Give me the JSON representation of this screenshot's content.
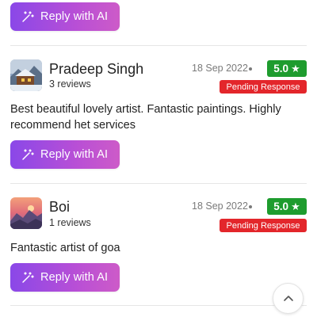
{
  "reply_button_label": "Reply with AI",
  "reviews": [
    {
      "name": "Pradeep Singh",
      "review_count": "3 reviews",
      "date": "18 Sep 2022",
      "rating": "5.0",
      "status": "Pending Response",
      "text": "Best beautiful lovely artist. Fantastic paintings. Highly recommend het services"
    },
    {
      "name": "Boi",
      "review_count": "1 reviews",
      "date": "18 Sep 2022",
      "rating": "5.0",
      "status": "Pending Response",
      "text": "Fantastic artist of goa"
    }
  ],
  "icons": {
    "reply_button": "magic-wand-icon",
    "rating": "star-icon",
    "scroll_top": "chevron-up-icon"
  },
  "colors": {
    "ai_button_gradient": [
      "#8a48e8",
      "#cd5bc8"
    ],
    "rating_badge": "#1e9c2e",
    "pending_badge": "#e3262b"
  }
}
